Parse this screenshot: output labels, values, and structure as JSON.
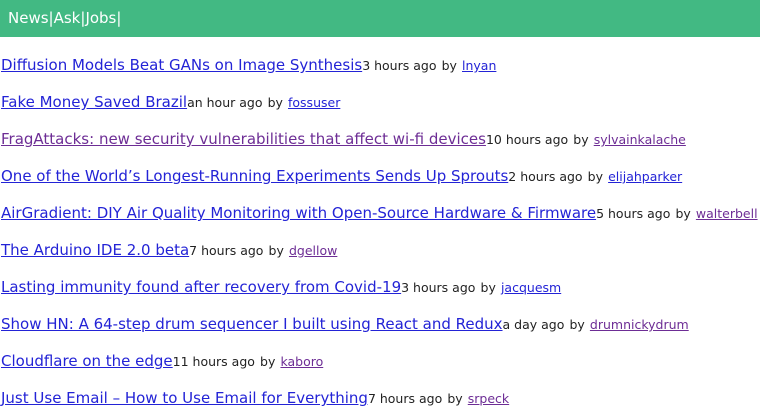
{
  "nav": {
    "links": [
      {
        "label": "News"
      },
      {
        "label": "Ask"
      },
      {
        "label": "Jobs"
      }
    ],
    "separator": "|"
  },
  "stories": [
    {
      "title": "Diffusion Models Beat GANs on Image Synthesis",
      "time": "3 hours ago",
      "by": "by",
      "user": "lnyan"
    },
    {
      "title": "Fake Money Saved Brazil",
      "time": "an hour ago",
      "by": "by",
      "user": "fossuser"
    },
    {
      "title": "FragAttacks: new security vulnerabilities that affect wi-fi devices",
      "time": "10 hours ago",
      "by": "by",
      "user": "sylvainkalache"
    },
    {
      "title": "One of the World’s Longest-Running Experiments Sends Up Sprouts",
      "time": "2 hours ago",
      "by": "by",
      "user": "elijahparker"
    },
    {
      "title": "AirGradient: DIY Air Quality Monitoring with Open-Source Hardware & Firmware",
      "time": "5 hours ago",
      "by": "by",
      "user": "walterbell"
    },
    {
      "title": "The Arduino IDE 2.0 beta",
      "time": "7 hours ago",
      "by": "by",
      "user": "dgellow"
    },
    {
      "title": "Lasting immunity found after recovery from Covid-19",
      "time": "3 hours ago",
      "by": "by",
      "user": "jacquesm"
    },
    {
      "title": "Show HN: A 64-step drum sequencer I built using React and Redux",
      "time": "a day ago",
      "by": "by",
      "user": "drumnickydrum"
    },
    {
      "title": "Cloudflare on the edge",
      "time": "11 hours ago",
      "by": "by",
      "user": "kaboro"
    },
    {
      "title": "Just Use Email – How to Use Email for Everything",
      "time": "7 hours ago",
      "by": "by",
      "user": "srpeck"
    }
  ],
  "colors": {
    "nav_bg": "#42b983",
    "link": "#2323d6",
    "visited": "#6d2d95"
  }
}
